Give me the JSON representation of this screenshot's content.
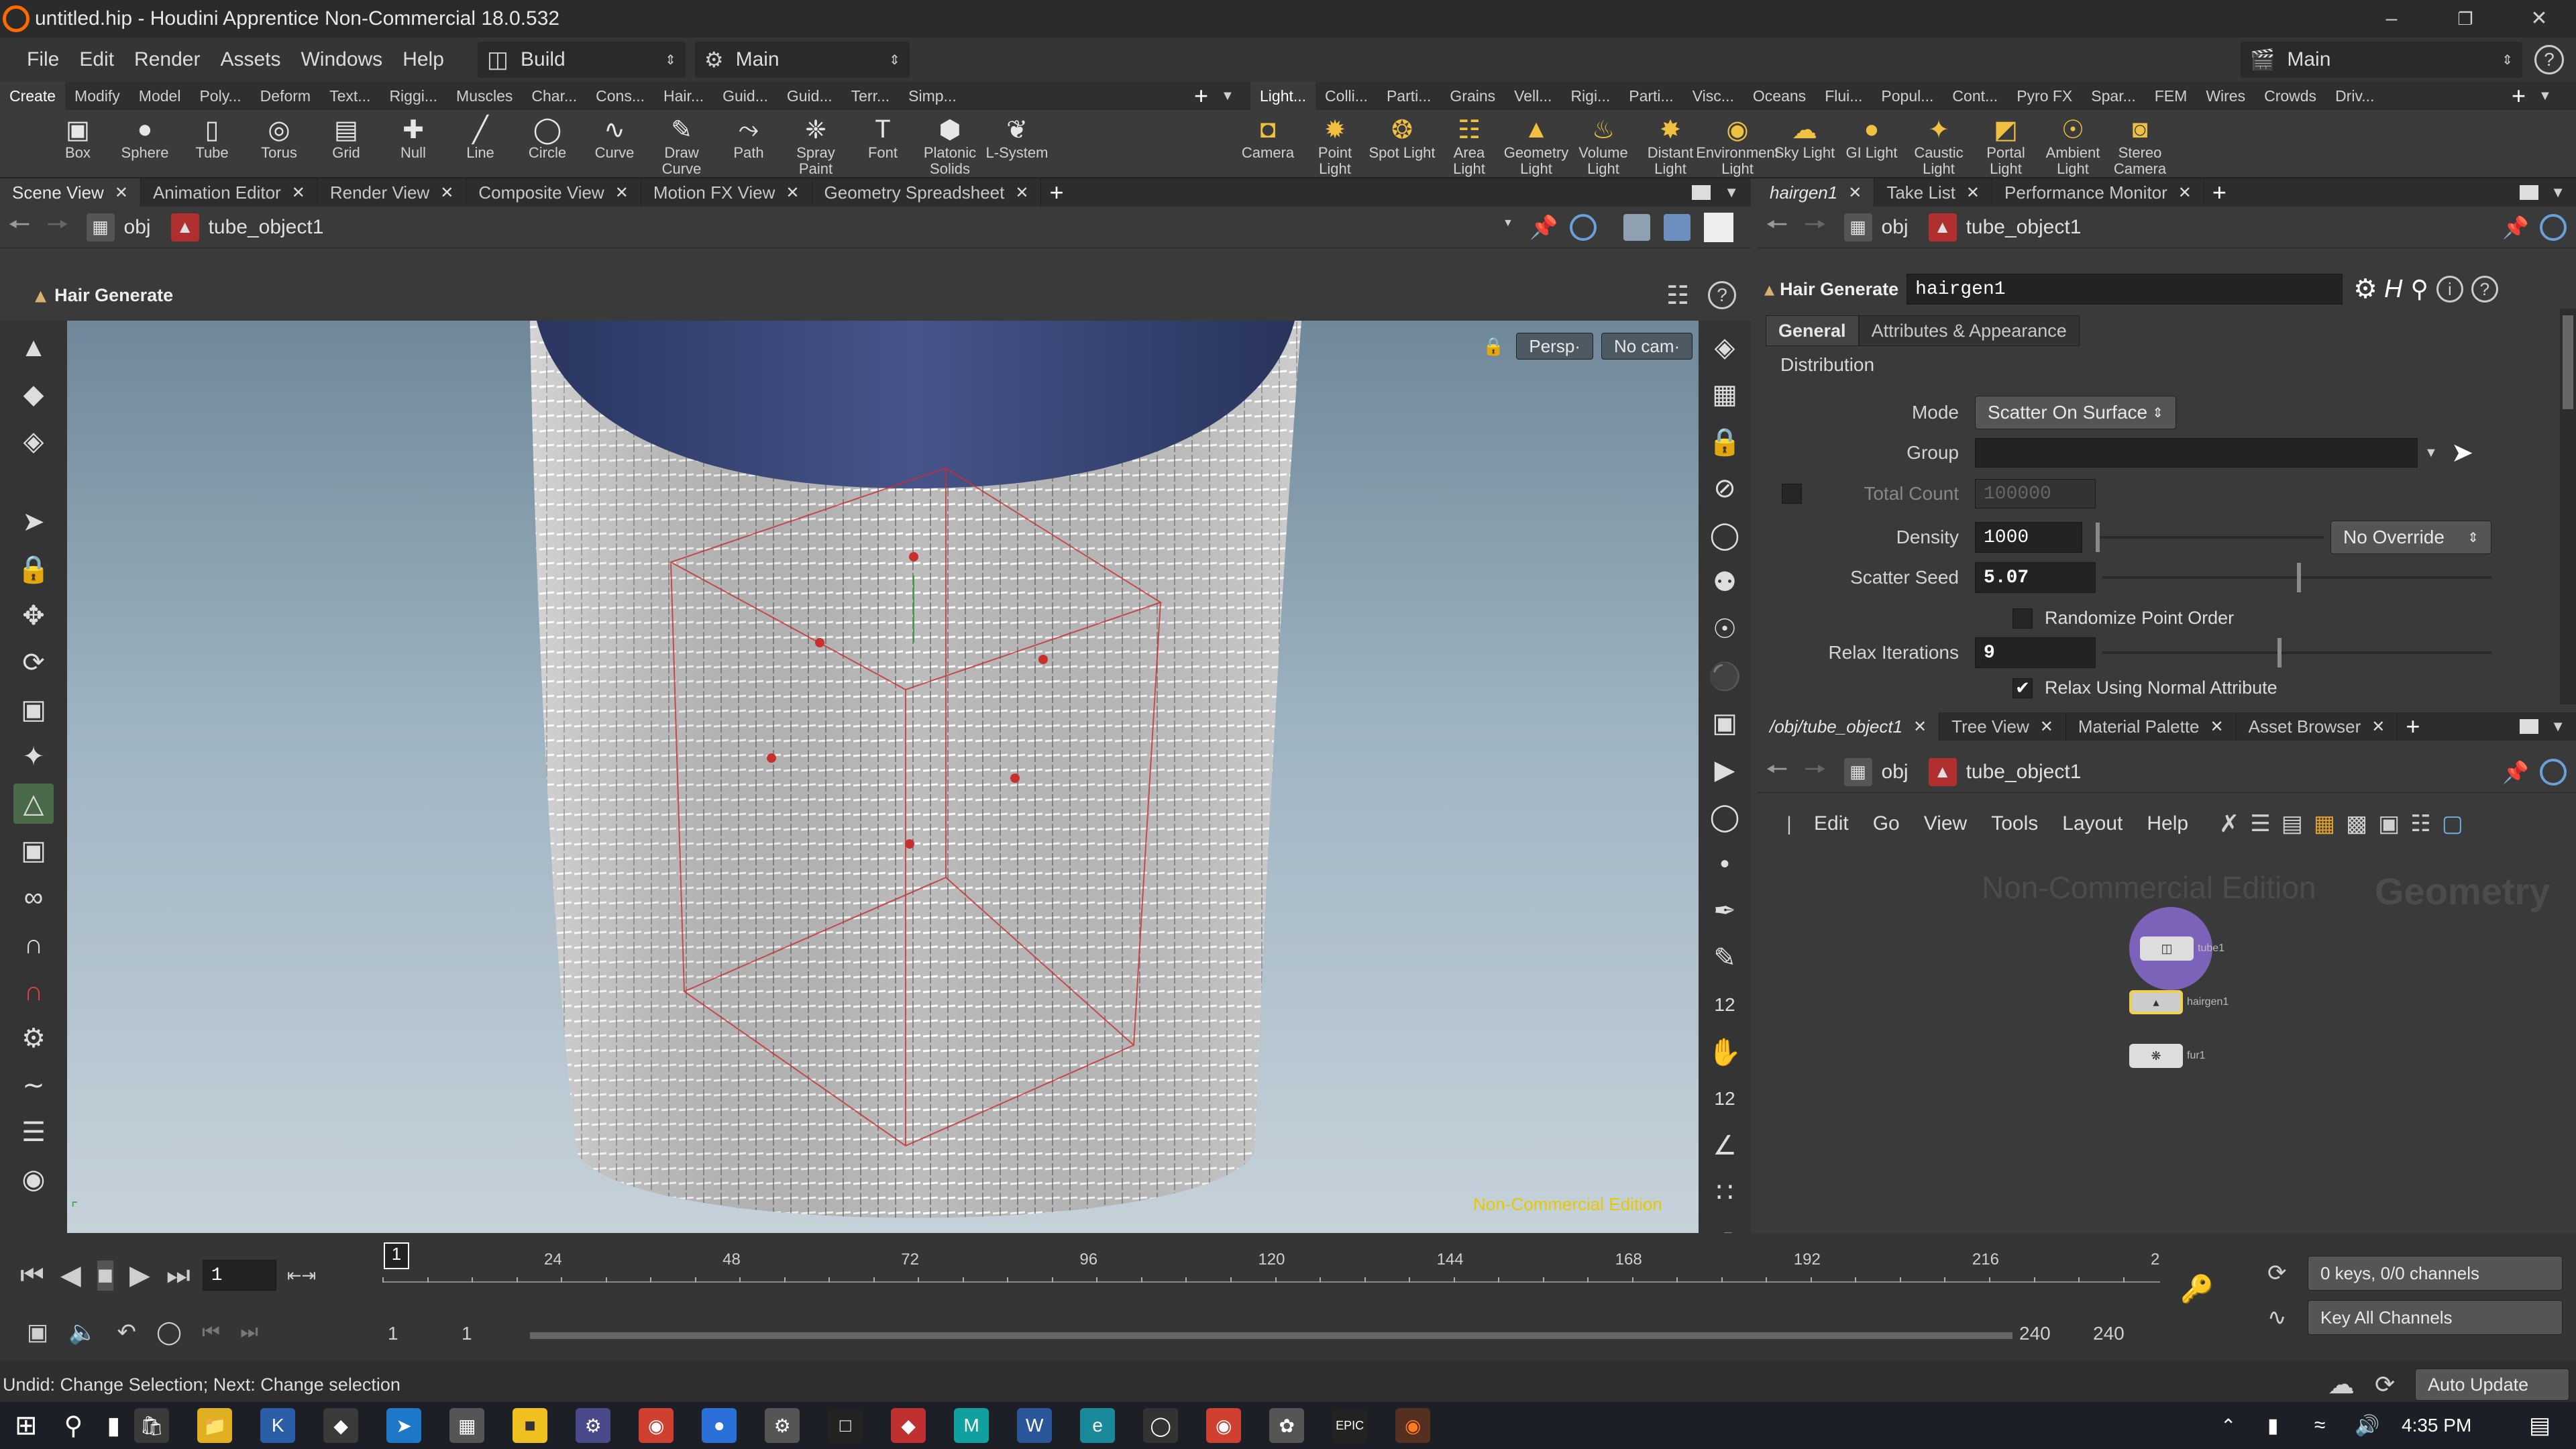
{
  "window": {
    "title": "untitled.hip - Houdini Apprentice Non-Commercial 18.0.532"
  },
  "menubar": {
    "items": [
      "File",
      "Edit",
      "Render",
      "Assets",
      "Windows",
      "Help"
    ],
    "desktop_left": "Build",
    "desktop_mid": "Main",
    "desktop_right": "Main"
  },
  "shelf_tabs_left": [
    "Create",
    "Modify",
    "Model",
    "Poly...",
    "Deform",
    "Text...",
    "Riggi...",
    "Muscles",
    "Char...",
    "Cons...",
    "Hair...",
    "Guid...",
    "Guid...",
    "Terr...",
    "Simp..."
  ],
  "shelf_tabs_right": [
    "Light...",
    "Colli...",
    "Parti...",
    "Grains",
    "Vell...",
    "Rigi...",
    "Parti...",
    "Visc...",
    "Oceans",
    "Flui...",
    "Popul...",
    "Cont...",
    "Pyro FX",
    "Spar...",
    "FEM",
    "Wires",
    "Crowds",
    "Driv..."
  ],
  "shelf_tools_left": [
    {
      "label": "Box",
      "icon": "box-icon"
    },
    {
      "label": "Sphere",
      "icon": "sphere-icon"
    },
    {
      "label": "Tube",
      "icon": "tube-icon"
    },
    {
      "label": "Torus",
      "icon": "torus-icon"
    },
    {
      "label": "Grid",
      "icon": "grid-icon"
    },
    {
      "label": "Null",
      "icon": "null-icon"
    },
    {
      "label": "Line",
      "icon": "line-icon"
    },
    {
      "label": "Circle",
      "icon": "circle-icon"
    },
    {
      "label": "Curve",
      "icon": "curve-icon"
    },
    {
      "label": "Draw Curve",
      "icon": "draw-curve-icon"
    },
    {
      "label": "Path",
      "icon": "path-icon"
    },
    {
      "label": "Spray Paint",
      "icon": "spray-paint-icon"
    },
    {
      "label": "Font",
      "icon": "font-icon"
    },
    {
      "label": "Platonic Solids",
      "icon": "platonic-icon"
    },
    {
      "label": "L-System",
      "icon": "lsystem-icon"
    }
  ],
  "shelf_tools_right": [
    {
      "label": "Camera",
      "icon": "camera-icon"
    },
    {
      "label": "Point Light",
      "icon": "point-light-icon"
    },
    {
      "label": "Spot Light",
      "icon": "spot-light-icon"
    },
    {
      "label": "Area Light",
      "icon": "area-light-icon"
    },
    {
      "label": "Geometry Light",
      "icon": "geometry-light-icon"
    },
    {
      "label": "Volume Light",
      "icon": "volume-light-icon"
    },
    {
      "label": "Distant Light",
      "icon": "distant-light-icon"
    },
    {
      "label": "Environment Light",
      "icon": "environment-light-icon"
    },
    {
      "label": "Sky Light",
      "icon": "sky-light-icon"
    },
    {
      "label": "GI Light",
      "icon": "gi-light-icon"
    },
    {
      "label": "Caustic Light",
      "icon": "caustic-light-icon"
    },
    {
      "label": "Portal Light",
      "icon": "portal-light-icon"
    },
    {
      "label": "Ambient Light",
      "icon": "ambient-light-icon"
    },
    {
      "label": "Stereo Camera",
      "icon": "stereo-camera-icon"
    }
  ],
  "left_panes": [
    "Scene View",
    "Animation Editor",
    "Render View",
    "Composite View",
    "Motion FX View",
    "Geometry Spreadsheet"
  ],
  "right_top_panes": [
    "hairgen1",
    "Take List",
    "Performance Monitor"
  ],
  "right_bottom_panes": [
    "/obj/tube_object1",
    "Tree View",
    "Material Palette",
    "Asset Browser"
  ],
  "path": {
    "root": "obj",
    "node": "tube_object1"
  },
  "viewport": {
    "tool_title": "Hair Generate",
    "persp": "Persp",
    "camera": "No cam",
    "watermark": "Non-Commercial Edition"
  },
  "params": {
    "operator": "Hair Generate",
    "node_name": "hairgen1",
    "tabs": [
      "General",
      "Attributes & Appearance"
    ],
    "section": "Distribution",
    "mode_label": "Mode",
    "mode_value": "Scatter On Surface",
    "group_label": "Group",
    "group_value": "",
    "total_count_label": "Total Count",
    "total_count_value": "100000",
    "density_label": "Density",
    "density_value": "1000",
    "density_override": "No Override",
    "scatter_seed_label": "Scatter Seed",
    "scatter_seed_value": "5.07",
    "scatter_seed_level": 0.5,
    "randomize_label": "Randomize Point Order",
    "randomize_checked": false,
    "relax_label": "Relax Iterations",
    "relax_value": "9",
    "relax_level": 0.45,
    "relax_normal_label": "Relax Using Normal Attribute",
    "relax_normal_checked": true
  },
  "network": {
    "menu": [
      "Edit",
      "Go",
      "View",
      "Tools",
      "Layout",
      "Help"
    ],
    "watermark": "Non-Commercial Edition",
    "context": "Geometry",
    "nodes": [
      {
        "name": "tube1",
        "icon": "tube-node-icon"
      },
      {
        "name": "hairgen1",
        "icon": "hairgen-node-icon"
      },
      {
        "name": "fur1",
        "icon": "fur-node-icon"
      }
    ]
  },
  "timeline": {
    "current_frame": "1",
    "ticks": [
      "1",
      "24",
      "48",
      "72",
      "96",
      "120",
      "144",
      "168",
      "192",
      "216",
      "2"
    ],
    "start": "1",
    "start2": "1",
    "end": "240",
    "end2": "240",
    "keys_info": "0 keys, 0/0 channels",
    "key_all": "Key All Channels"
  },
  "status": {
    "message": "Undid: Change Selection; Next: Change selection",
    "auto_update": "Auto Update"
  },
  "taskbar": {
    "time": "4:35 PM"
  },
  "colors": {
    "accent": "#ff8a00",
    "watermark": "#e8c800",
    "node_selected": "#f0d050"
  }
}
